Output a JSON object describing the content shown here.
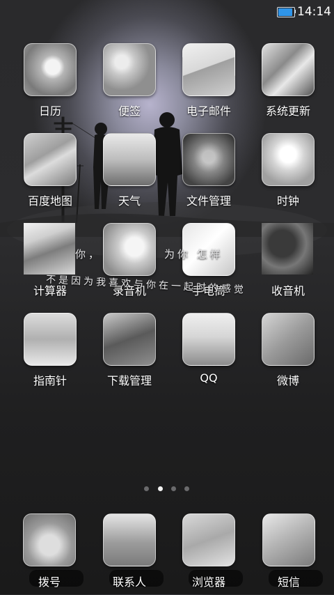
{
  "status_bar": {
    "time": "14:14",
    "battery_level": 0.9,
    "battery_color": "#2f95ea"
  },
  "lyrics": {
    "line1": "ó你，为你笑怎样",
    "line1b": "你，",
    "line2": "不是因为我喜欢与你在一起时的感觉"
  },
  "apps": [
    {
      "label": "日历",
      "icon": "calendar-icon"
    },
    {
      "label": "便签",
      "icon": "notes-icon"
    },
    {
      "label": "电子邮件",
      "icon": "email-icon"
    },
    {
      "label": "系统更新",
      "icon": "system-update-icon"
    },
    {
      "label": "百度地图",
      "icon": "baidu-map-icon"
    },
    {
      "label": "天气",
      "icon": "weather-icon"
    },
    {
      "label": "文件管理",
      "icon": "file-manager-icon"
    },
    {
      "label": "时钟",
      "icon": "clock-icon"
    },
    {
      "label": "计算器",
      "icon": "calculator-icon"
    },
    {
      "label": "录音机",
      "icon": "recorder-icon"
    },
    {
      "label": "手电筒",
      "icon": "flashlight-icon"
    },
    {
      "label": "收音机",
      "icon": "radio-icon"
    },
    {
      "label": "指南针",
      "icon": "compass-icon"
    },
    {
      "label": "下载管理",
      "icon": "download-manager-icon"
    },
    {
      "label": "QQ",
      "icon": "qq-icon"
    },
    {
      "label": "微博",
      "icon": "weibo-icon"
    }
  ],
  "page_indicator": {
    "total": 4,
    "current": 2
  },
  "dock": [
    {
      "label": "拨号",
      "icon": "dialer-icon"
    },
    {
      "label": "联系人",
      "icon": "contacts-icon"
    },
    {
      "label": "浏览器",
      "icon": "browser-icon"
    },
    {
      "label": "短信",
      "icon": "messages-icon"
    }
  ]
}
